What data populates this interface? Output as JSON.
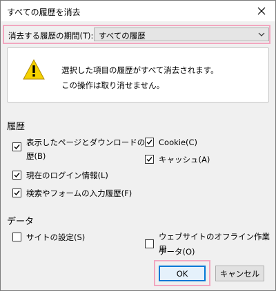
{
  "window": {
    "title": "すべての履歴を消去",
    "close": "×"
  },
  "range": {
    "label": "消去する履歴の期間(T):",
    "selected": "すべての履歴"
  },
  "warning": {
    "line1": "選択した項目の履歴がすべて消去されます。",
    "line2": "この操作は取り消せません。"
  },
  "history": {
    "heading": "履歴",
    "items": [
      {
        "label_line1": "表示したページとダウンロードの履",
        "label_line2": "歴(B)",
        "checked": true
      },
      {
        "label": "現在のログイン情報(L)",
        "checked": true
      },
      {
        "label": "検索やフォームの入力履歴(F)",
        "checked": true
      },
      {
        "label": "Cookie(C)",
        "checked": true
      },
      {
        "label": "キャッシュ(A)",
        "checked": true
      }
    ]
  },
  "data_section": {
    "heading": "データ",
    "items": [
      {
        "label": "サイトの設定(S)",
        "checked": false
      },
      {
        "label_line1": "ウェブサイトのオフライン作業用",
        "label_line2": "データ(O)",
        "checked": false
      }
    ]
  },
  "buttons": {
    "ok": "OK",
    "cancel": "キャンセル"
  },
  "colors": {
    "highlight": "#f2a7c0",
    "focus": "#0078d7",
    "warning_yellow": "#f5d200"
  }
}
